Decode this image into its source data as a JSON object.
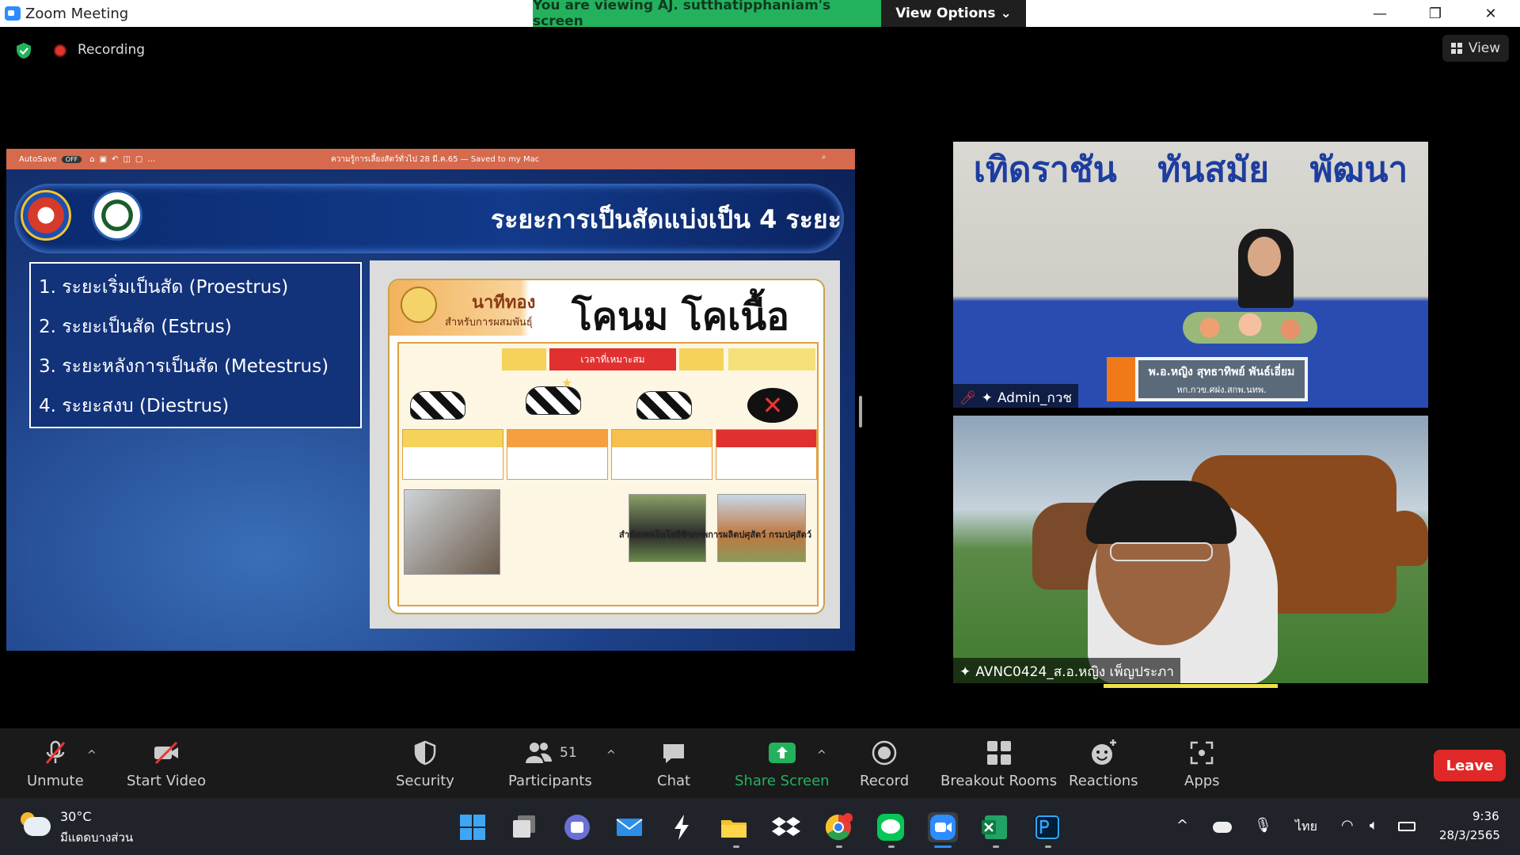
{
  "window": {
    "app_title": "Zoom Meeting",
    "viewing_banner": "You are viewing AJ. sutthatipphaniam's screen",
    "view_options": "View Options",
    "minimize": "—",
    "restore": "❐",
    "close": "✕"
  },
  "status": {
    "recording": "Recording",
    "view": "View"
  },
  "shared": {
    "ppt_autosave": "AutoSave",
    "ppt_autosave_state": "OFF",
    "ppt_doc_title": "ความรู้การเลี้ยงสัตว์ทั่วไป 28 มี.ค.65 — Saved to my Mac",
    "slide_title": "ระยะการเป็นสัดแบ่งเป็น 4 ระยะ",
    "stages": [
      "1. ระยะเริ่มเป็นสัด (Proestrus)",
      "2. ระยะเป็นสัด (Estrus)",
      "3. ระยะหลังการเป็นสัด (Metestrus)",
      "4. ระยะสงบ (Diestrus)"
    ],
    "poster": {
      "brand": "นาทีทอง",
      "brand_sub": "สำหรับการผสมพันธุ์",
      "title": "โคนม โคเนื้อ",
      "best_time": "เวลาที่เหมาะสม",
      "caption": "สำนักเทคโนโลยีชีวภาพการผลิตปศุสัตว์ กรมปศุสัตว์"
    }
  },
  "participants_tiles": [
    {
      "banner_words": [
        "เทิดราชัน",
        "ทันสมัย",
        "พัฒนา"
      ],
      "namecard_line1": "พ.อ.หญิง สุทธาทิพย์ พันธ์เอี่ยม",
      "namecard_line2": "หก.กวข.ศฝง.สกพ.นทพ.",
      "name": "Admin_กวช"
    },
    {
      "name": "AVNC0424_ส.อ.หญิง เพ็ญประภา"
    }
  ],
  "toolbar": {
    "unmute": "Unmute",
    "start_video": "Start Video",
    "security": "Security",
    "participants": "Participants",
    "participants_count": "51",
    "chat": "Chat",
    "share_screen": "Share Screen",
    "record": "Record",
    "breakout_rooms": "Breakout Rooms",
    "reactions": "Reactions",
    "apps": "Apps",
    "leave": "Leave"
  },
  "taskbar": {
    "temperature": "30°C",
    "weather": "มีแดดบางส่วน",
    "language": "ไทย",
    "time": "9:36",
    "date": "28/3/2565"
  },
  "colors": {
    "share_green": "#23b15d",
    "leave_red": "#e02828",
    "zoom_blue": "#2d8cff"
  }
}
